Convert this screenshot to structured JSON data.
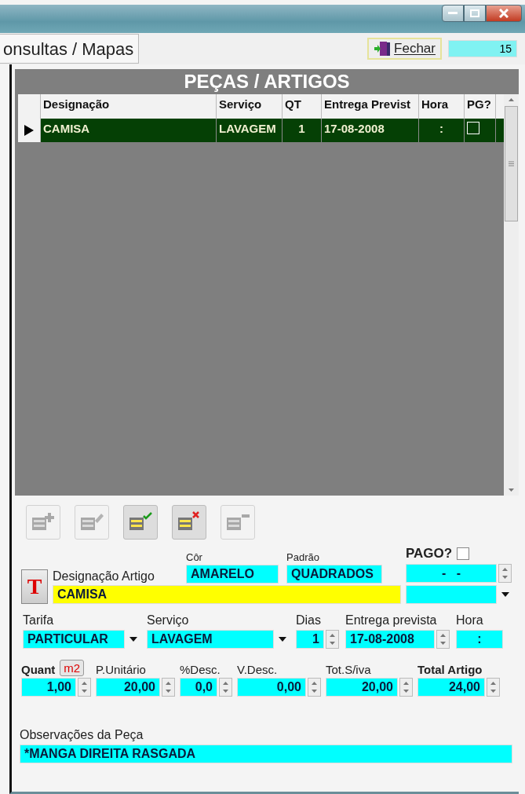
{
  "tab": {
    "label": "onsultas / Mapas"
  },
  "close_button": {
    "label": "Fechar"
  },
  "record_counter": "15",
  "grid": {
    "title": "PEÇAS / ARTIGOS",
    "columns": [
      "Designação",
      "Serviço",
      "QT",
      "Entrega Previst",
      "Hora",
      "PG?"
    ],
    "rows": [
      {
        "selected": true,
        "cells": [
          "CAMISA",
          "LAVAGEM",
          "1",
          "17-08-2008",
          ":"
        ],
        "paid": false
      }
    ]
  },
  "toolbar": [
    {
      "kind": "add",
      "disabled": true
    },
    {
      "kind": "edit",
      "disabled": true
    },
    {
      "kind": "confirm",
      "disabled": false
    },
    {
      "kind": "cancel",
      "disabled": false
    },
    {
      "kind": "remove",
      "disabled": true
    }
  ],
  "article": {
    "label": "Designação Artigo",
    "value": "CAMISA",
    "color_label": "Côr",
    "color_value": "AMARELO",
    "pattern_label": "Padrão",
    "pattern_value": "QUADRADOS",
    "paid_label": "PAGO?",
    "paid": false,
    "paid_date": "-   -"
  },
  "row2": [
    {
      "kind": "dropdown",
      "label": "Tarifa",
      "value": "PARTICULAR"
    },
    {
      "kind": "dropdown",
      "label": "Serviço",
      "value": "LAVAGEM"
    },
    {
      "kind": "spin",
      "label": "Dias",
      "value": "1"
    },
    {
      "kind": "spin",
      "label": "Entrega prevista",
      "value": "17-08-2008"
    },
    {
      "kind": "plain",
      "label": "Hora",
      "value": ":"
    }
  ],
  "unit_button": "m2",
  "format_button": "T",
  "row3": [
    {
      "label": "Quant",
      "value": "1,00",
      "strong": true
    },
    {
      "label": "P.Unitário",
      "value": "20,00",
      "strong": false
    },
    {
      "label": "%Desc.",
      "value": "0,0",
      "strong": false
    },
    {
      "label": "V.Desc.",
      "value": "0,00",
      "strong": false
    },
    {
      "label": "Tot.S/iva",
      "value": "20,00",
      "strong": false
    },
    {
      "label": "Total Artigo",
      "value": "24,00",
      "strong": true
    }
  ],
  "notes": {
    "label": "Observações da Peça",
    "value": "*MANGA DIREITA RASGADA"
  }
}
